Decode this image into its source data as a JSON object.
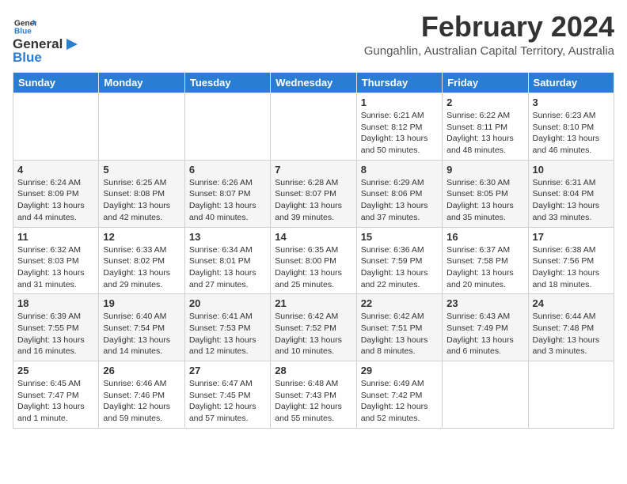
{
  "logo": {
    "line1": "General",
    "line2": "Blue"
  },
  "header": {
    "month": "February 2024",
    "subtitle": "Gungahlin, Australian Capital Territory, Australia"
  },
  "weekdays": [
    "Sunday",
    "Monday",
    "Tuesday",
    "Wednesday",
    "Thursday",
    "Friday",
    "Saturday"
  ],
  "weeks": [
    [
      null,
      null,
      null,
      null,
      {
        "day": "1",
        "sunrise": "6:21 AM",
        "sunset": "8:12 PM",
        "daylight": "13 hours and 50 minutes."
      },
      {
        "day": "2",
        "sunrise": "6:22 AM",
        "sunset": "8:11 PM",
        "daylight": "13 hours and 48 minutes."
      },
      {
        "day": "3",
        "sunrise": "6:23 AM",
        "sunset": "8:10 PM",
        "daylight": "13 hours and 46 minutes."
      }
    ],
    [
      {
        "day": "4",
        "sunrise": "6:24 AM",
        "sunset": "8:09 PM",
        "daylight": "13 hours and 44 minutes."
      },
      {
        "day": "5",
        "sunrise": "6:25 AM",
        "sunset": "8:08 PM",
        "daylight": "13 hours and 42 minutes."
      },
      {
        "day": "6",
        "sunrise": "6:26 AM",
        "sunset": "8:07 PM",
        "daylight": "13 hours and 40 minutes."
      },
      {
        "day": "7",
        "sunrise": "6:28 AM",
        "sunset": "8:07 PM",
        "daylight": "13 hours and 39 minutes."
      },
      {
        "day": "8",
        "sunrise": "6:29 AM",
        "sunset": "8:06 PM",
        "daylight": "13 hours and 37 minutes."
      },
      {
        "day": "9",
        "sunrise": "6:30 AM",
        "sunset": "8:05 PM",
        "daylight": "13 hours and 35 minutes."
      },
      {
        "day": "10",
        "sunrise": "6:31 AM",
        "sunset": "8:04 PM",
        "daylight": "13 hours and 33 minutes."
      }
    ],
    [
      {
        "day": "11",
        "sunrise": "6:32 AM",
        "sunset": "8:03 PM",
        "daylight": "13 hours and 31 minutes."
      },
      {
        "day": "12",
        "sunrise": "6:33 AM",
        "sunset": "8:02 PM",
        "daylight": "13 hours and 29 minutes."
      },
      {
        "day": "13",
        "sunrise": "6:34 AM",
        "sunset": "8:01 PM",
        "daylight": "13 hours and 27 minutes."
      },
      {
        "day": "14",
        "sunrise": "6:35 AM",
        "sunset": "8:00 PM",
        "daylight": "13 hours and 25 minutes."
      },
      {
        "day": "15",
        "sunrise": "6:36 AM",
        "sunset": "7:59 PM",
        "daylight": "13 hours and 22 minutes."
      },
      {
        "day": "16",
        "sunrise": "6:37 AM",
        "sunset": "7:58 PM",
        "daylight": "13 hours and 20 minutes."
      },
      {
        "day": "17",
        "sunrise": "6:38 AM",
        "sunset": "7:56 PM",
        "daylight": "13 hours and 18 minutes."
      }
    ],
    [
      {
        "day": "18",
        "sunrise": "6:39 AM",
        "sunset": "7:55 PM",
        "daylight": "13 hours and 16 minutes."
      },
      {
        "day": "19",
        "sunrise": "6:40 AM",
        "sunset": "7:54 PM",
        "daylight": "13 hours and 14 minutes."
      },
      {
        "day": "20",
        "sunrise": "6:41 AM",
        "sunset": "7:53 PM",
        "daylight": "13 hours and 12 minutes."
      },
      {
        "day": "21",
        "sunrise": "6:42 AM",
        "sunset": "7:52 PM",
        "daylight": "13 hours and 10 minutes."
      },
      {
        "day": "22",
        "sunrise": "6:42 AM",
        "sunset": "7:51 PM",
        "daylight": "13 hours and 8 minutes."
      },
      {
        "day": "23",
        "sunrise": "6:43 AM",
        "sunset": "7:49 PM",
        "daylight": "13 hours and 6 minutes."
      },
      {
        "day": "24",
        "sunrise": "6:44 AM",
        "sunset": "7:48 PM",
        "daylight": "13 hours and 3 minutes."
      }
    ],
    [
      {
        "day": "25",
        "sunrise": "6:45 AM",
        "sunset": "7:47 PM",
        "daylight": "13 hours and 1 minute."
      },
      {
        "day": "26",
        "sunrise": "6:46 AM",
        "sunset": "7:46 PM",
        "daylight": "12 hours and 59 minutes."
      },
      {
        "day": "27",
        "sunrise": "6:47 AM",
        "sunset": "7:45 PM",
        "daylight": "12 hours and 57 minutes."
      },
      {
        "day": "28",
        "sunrise": "6:48 AM",
        "sunset": "7:43 PM",
        "daylight": "12 hours and 55 minutes."
      },
      {
        "day": "29",
        "sunrise": "6:49 AM",
        "sunset": "7:42 PM",
        "daylight": "12 hours and 52 minutes."
      },
      null,
      null
    ]
  ],
  "labels": {
    "sunrise": "Sunrise:",
    "sunset": "Sunset:",
    "daylight": "Daylight:"
  }
}
